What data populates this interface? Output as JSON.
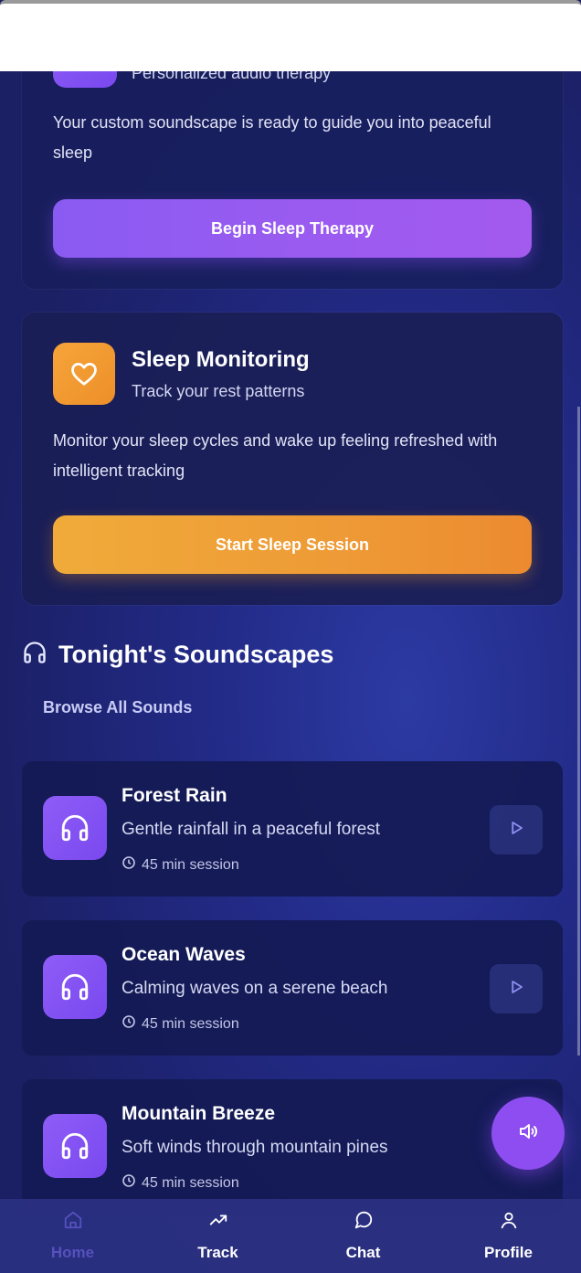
{
  "therapy_card": {
    "subtitle": "Personalized audio therapy",
    "description": "Your custom soundscape is ready to guide you into peaceful sleep",
    "button_label": "Begin Sleep Therapy"
  },
  "monitor_card": {
    "title": "Sleep Monitoring",
    "subtitle": "Track your rest patterns",
    "description": "Monitor your sleep cycles and wake up feeling refreshed with intelligent tracking",
    "button_label": "Start Sleep Session"
  },
  "soundscapes": {
    "title": "Tonight's Soundscapes",
    "browse_label": "Browse All Sounds",
    "items": [
      {
        "name": "Forest Rain",
        "description": "Gentle rainfall in a peaceful forest",
        "duration": "45 min session"
      },
      {
        "name": "Ocean Waves",
        "description": "Calming waves on a serene beach",
        "duration": "45 min session"
      },
      {
        "name": "Mountain Breeze",
        "description": "Soft winds through mountain pines",
        "duration": "45 min session"
      }
    ]
  },
  "bottom_nav": {
    "items": [
      {
        "label": "Home",
        "icon": "home-icon",
        "active": true
      },
      {
        "label": "Track",
        "icon": "trending-icon",
        "active": false
      },
      {
        "label": "Chat",
        "icon": "chat-icon",
        "active": false
      },
      {
        "label": "Profile",
        "icon": "user-icon",
        "active": false
      }
    ]
  },
  "colors": {
    "background": "#1b1f63",
    "accent_purple": "#8e5cf6",
    "accent_orange": "#f0a33a"
  }
}
